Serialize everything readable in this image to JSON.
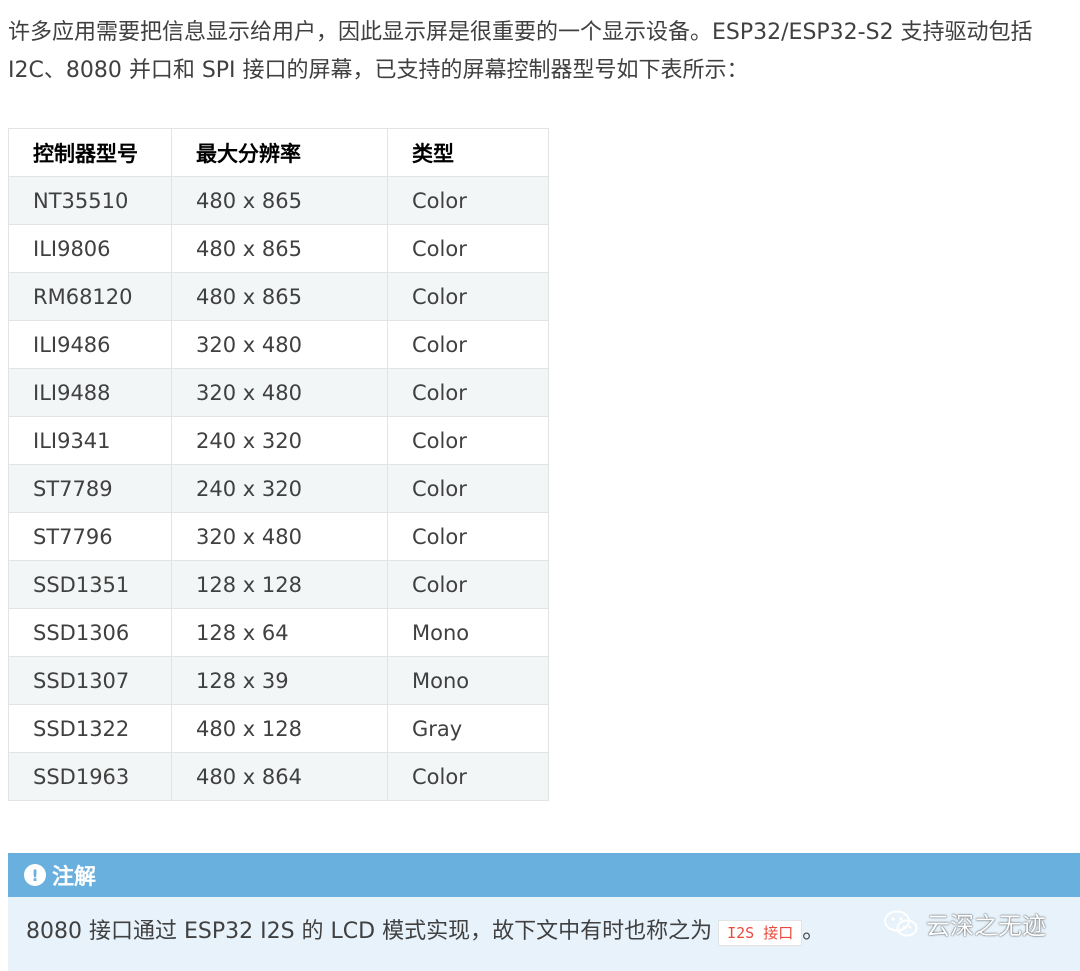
{
  "intro": {
    "text": "许多应用需要把信息显示给用户，因此显示屏是很重要的一个显示设备。ESP32/ESP32-S2 支持驱动包括 I2C、8080 并口和 SPI 接口的屏幕，已支持的屏幕控制器型号如下表所示："
  },
  "table": {
    "headers": [
      "控制器型号",
      "最大分辨率",
      "类型"
    ],
    "rows": [
      [
        "NT35510",
        "480 x 865",
        "Color"
      ],
      [
        "ILI9806",
        "480 x 865",
        "Color"
      ],
      [
        "RM68120",
        "480 x 865",
        "Color"
      ],
      [
        "ILI9486",
        "320 x 480",
        "Color"
      ],
      [
        "ILI9488",
        "320 x 480",
        "Color"
      ],
      [
        "ILI9341",
        "240 x 320",
        "Color"
      ],
      [
        "ST7789",
        "240 x 320",
        "Color"
      ],
      [
        "ST7796",
        "320 x 480",
        "Color"
      ],
      [
        "SSD1351",
        "128 x 128",
        "Color"
      ],
      [
        "SSD1306",
        "128 x 64",
        "Mono"
      ],
      [
        "SSD1307",
        "128 x 39",
        "Mono"
      ],
      [
        "SSD1322",
        "480 x 128",
        "Gray"
      ],
      [
        "SSD1963",
        "480 x 864",
        "Color"
      ]
    ]
  },
  "note": {
    "icon": "exclamation-circle-icon",
    "title": "注解",
    "body_text": "8080 接口通过 ESP32 I2S 的 LCD 模式实现，故下文中有时也称之为",
    "code": "I2S 接口",
    "trailing": "。",
    "header_color": "#6ab0de",
    "body_color": "#e7f2fa"
  },
  "watermark": {
    "icon": "wechat-icon",
    "text": "云深之无迹"
  }
}
